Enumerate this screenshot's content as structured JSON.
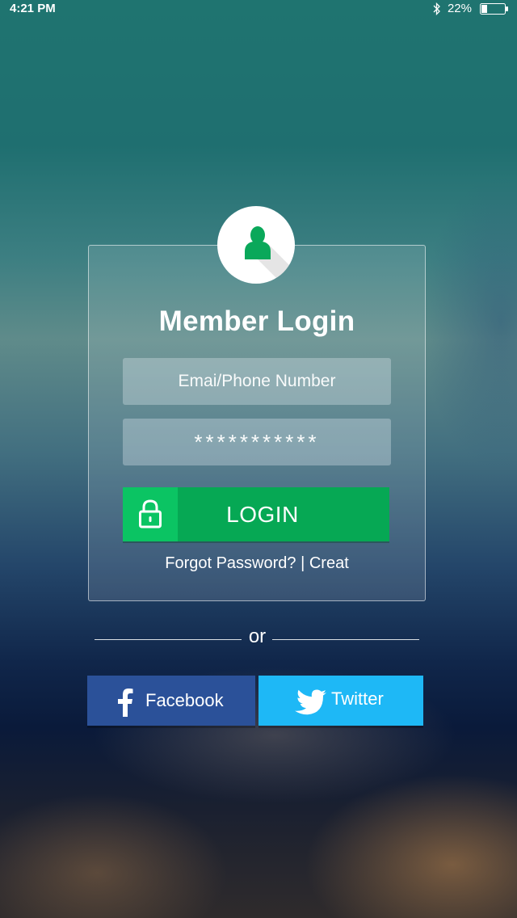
{
  "status_bar": {
    "time": "4:21 PM",
    "battery": "22%",
    "icons": [
      "bluetooth-icon",
      "battery-icon"
    ]
  },
  "login_card": {
    "avatar_icon": "user-icon",
    "title": "Member Login",
    "email_placeholder": "Emai/Phone Number",
    "password_value": "***********",
    "lock_icon": "lock-icon",
    "login_label": "LOGIN",
    "forgot_label": "Forgot Password?",
    "separator": "|",
    "create_label": "Creat"
  },
  "divider": {
    "label": "or"
  },
  "social": {
    "facebook_label": "Facebook",
    "twitter_label": "Twitter"
  },
  "colors": {
    "login_green": "#06a854",
    "lock_green": "#0bc463",
    "facebook_blue": "#2b5199",
    "twitter_blue": "#1eb8f6"
  }
}
